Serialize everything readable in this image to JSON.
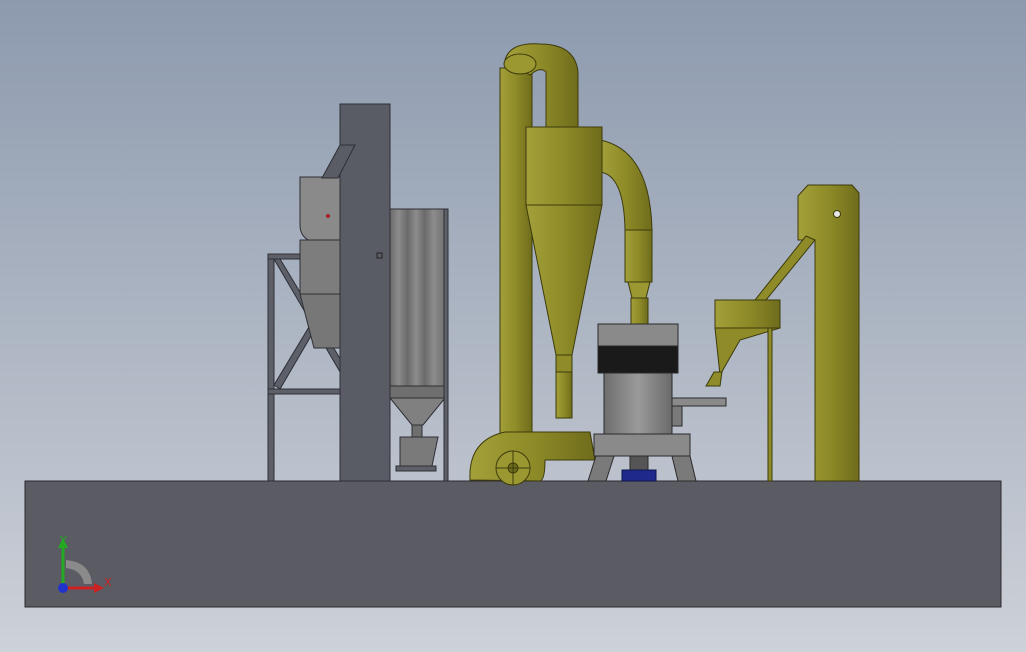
{
  "colors": {
    "bg_top": "#8d9aae",
    "bg_bottom": "#c9ced6",
    "base_slab": "#5a5b63",
    "steel_gray": "#5d5f69",
    "olive": "#8f8c2b",
    "olive_dark": "#6f6c1c",
    "silver": "#8a8a8a",
    "motor_blue": "#1d2a8c",
    "axis_x": "#cc2222",
    "axis_y": "#22aa22",
    "axis_z": "#2233cc"
  },
  "triad": {
    "x_label": "X",
    "y_label": "Y"
  },
  "scene": {
    "parts": [
      "base-slab",
      "dust-collector-frame",
      "bag-filter",
      "elevator-column",
      "cyclone-collector",
      "air-duct",
      "blower",
      "grinding-mill",
      "main-motor",
      "feeder-hopper",
      "bucket-elevator"
    ]
  }
}
